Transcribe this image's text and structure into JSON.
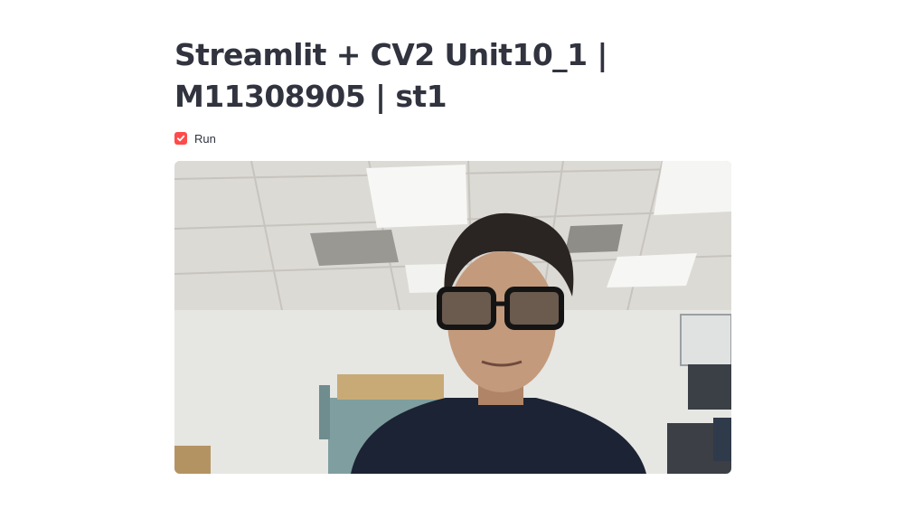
{
  "page": {
    "title": "Streamlit + CV2 Unit10_1 | M11308905 | st1"
  },
  "controls": {
    "run_label": "Run",
    "run_checked": true
  },
  "camera": {
    "icon": "webcam-frame"
  },
  "colors": {
    "accent": "#ff4b4b",
    "text": "#31333f",
    "background": "#ffffff"
  }
}
